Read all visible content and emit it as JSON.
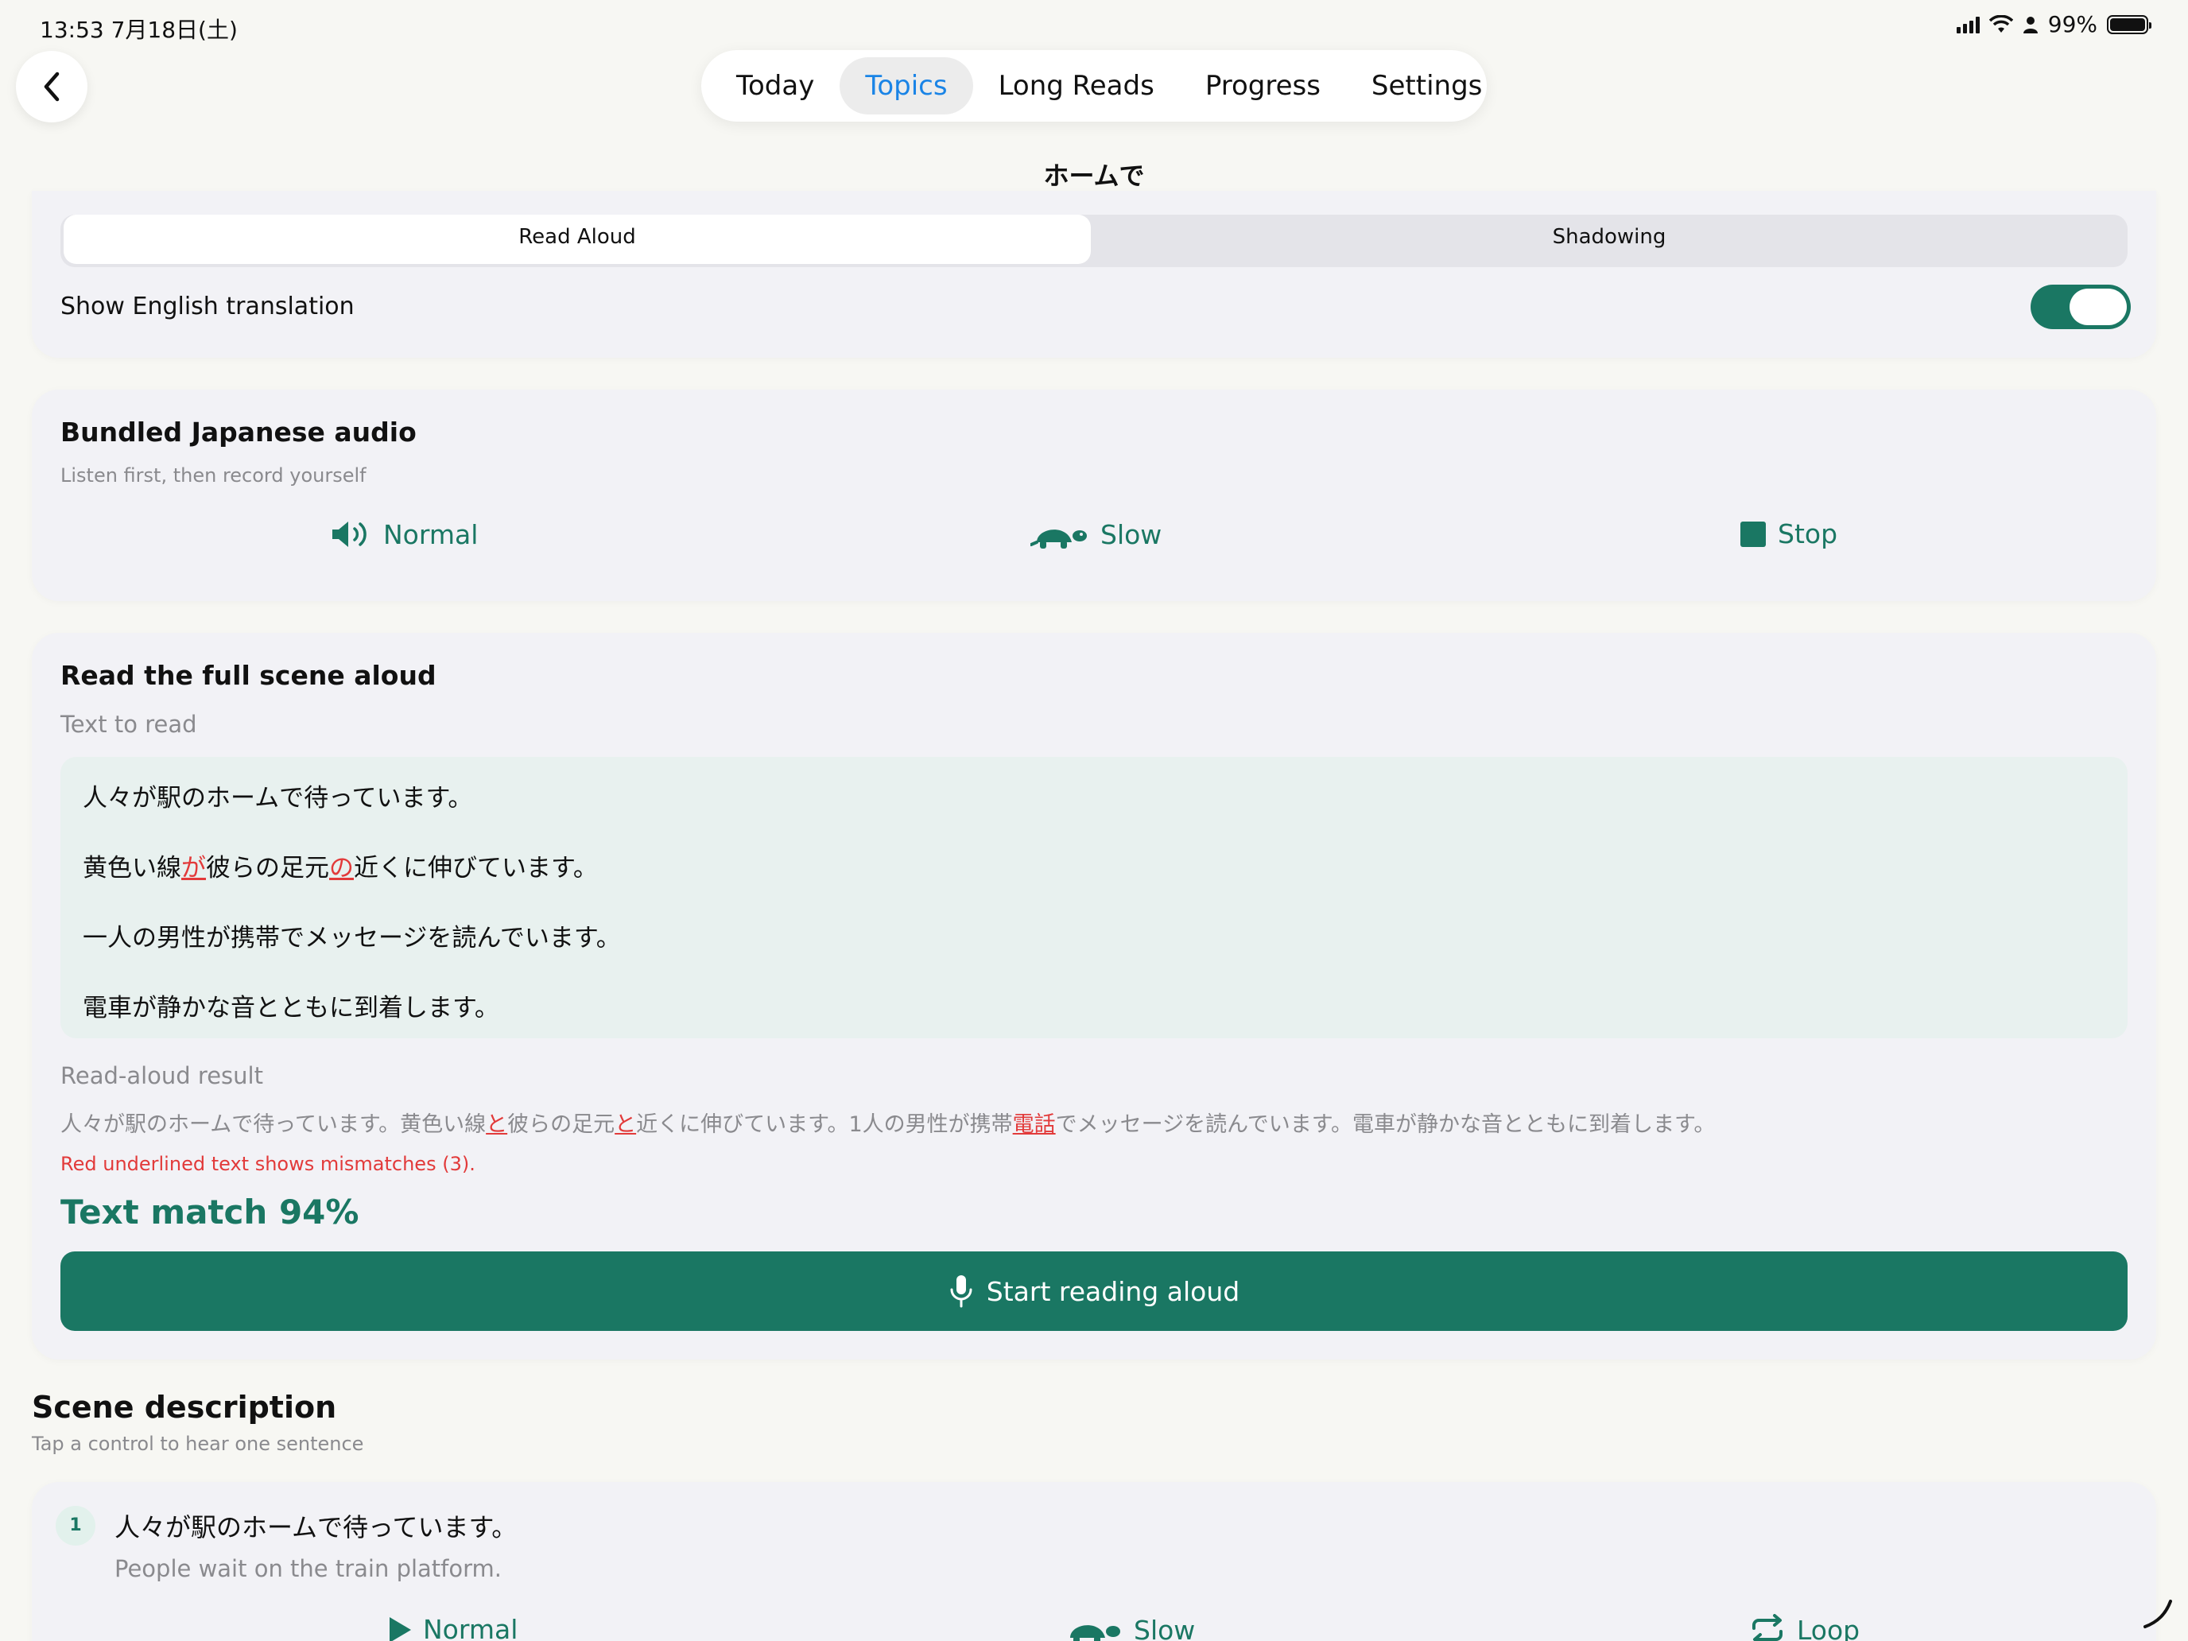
{
  "status_bar": {
    "time": "13:53  7月18日(土)",
    "battery": "99%"
  },
  "nav": {
    "tabs": [
      {
        "label": "Today",
        "active": false
      },
      {
        "label": "Topics",
        "active": true
      },
      {
        "label": "Long Reads",
        "active": false
      },
      {
        "label": "Progress",
        "active": false
      },
      {
        "label": "Settings",
        "active": false
      }
    ],
    "page_title": "ホームで"
  },
  "mode": {
    "read_aloud": "Read Aloud",
    "shadowing": "Shadowing",
    "selected": "Read Aloud",
    "translation_label": "Show English translation",
    "translation_on": true
  },
  "audio": {
    "title": "Bundled Japanese audio",
    "subtitle": "Listen first, then record yourself",
    "normal": "Normal",
    "slow": "Slow",
    "stop": "Stop"
  },
  "read": {
    "title": "Read the full scene aloud",
    "text_label": "Text to read",
    "lines": {
      "l1": "人々が駅のホームで待っています。",
      "l2a": "黄色い線",
      "l2b": "が",
      "l2c": "彼らの足元",
      "l2d": "の",
      "l2e": "近くに伸びています。",
      "l3": "一人の男性が携帯でメッセージを読んでいます。",
      "l4": "電車が静かな音とともに到着します。"
    },
    "result_label": "Read-aloud result",
    "result": {
      "r1": "人々が駅のホームで待っています。黄色い線",
      "r2": "と",
      "r3": "彼らの足元",
      "r4": "と",
      "r5": "近くに伸びています。1人の男性が携帯",
      "r6": "電話",
      "r7": "でメッセージを読んでいます。電車が静かな音とともに到着します。"
    },
    "mismatch_note": "Red underlined text shows mismatches (3).",
    "match_score": "Text match 94%",
    "start_button": "Start reading aloud"
  },
  "scene": {
    "title": "Scene description",
    "subtitle": "Tap a control to hear one sentence",
    "sentence": {
      "number": "1",
      "jp": "人々が駅のホームで待っています。",
      "en": "People wait on the train platform.",
      "normal": "Normal",
      "slow": "Slow",
      "loop": "Loop"
    }
  },
  "colors": {
    "accent_green": "#1a7763",
    "active_tab_blue": "#1a84e6",
    "mismatch_red": "#e23a3a"
  }
}
